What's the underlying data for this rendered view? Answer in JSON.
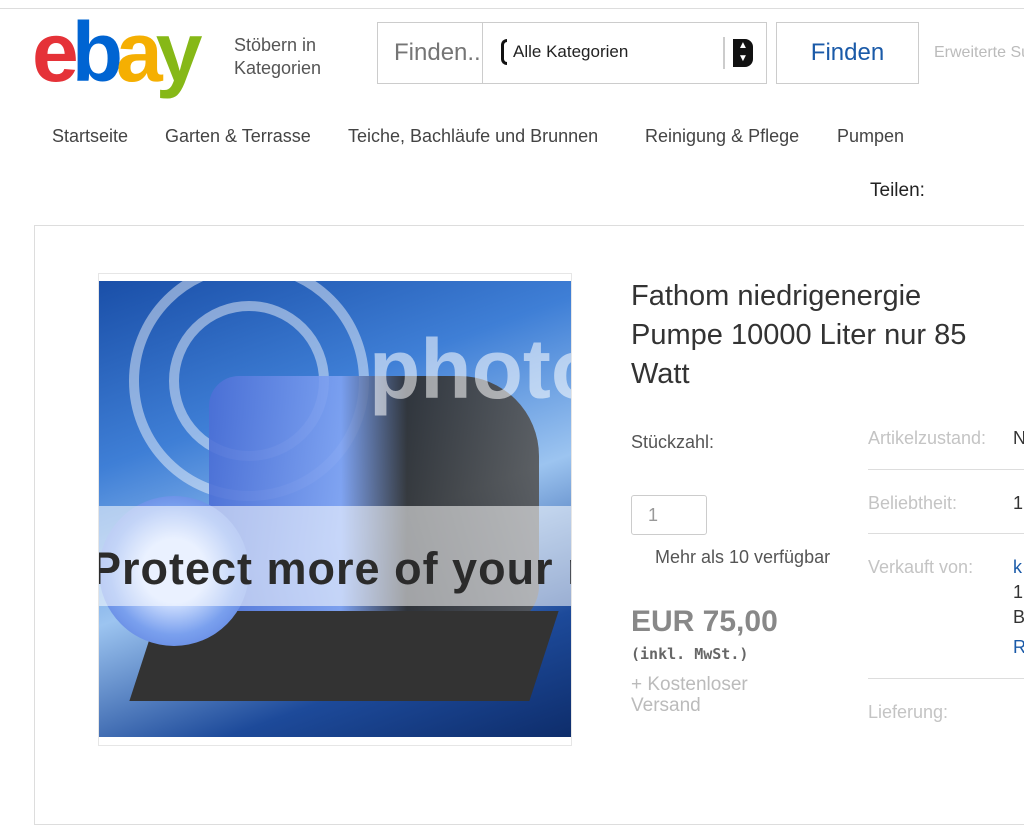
{
  "header": {
    "logo_letters": [
      "e",
      "b",
      "a",
      "y"
    ],
    "logo_colors": [
      "#e53238",
      "#0064d2",
      "#f5af02",
      "#86b817"
    ],
    "browse_label_line1": "Stöbern in",
    "browse_label_line2": "Kategorien",
    "search_placeholder": "Finden...",
    "category_selected": "Alle Kategorien",
    "find_button": "Finden",
    "advanced_link": "Erweiterte Suche"
  },
  "breadcrumbs": [
    "Startseite",
    "Garten & Terrasse",
    "Teiche, Bachläufe und Brunnen",
    "Reinigung & Pflege",
    "Pumpen"
  ],
  "share_label": "Teilen:",
  "product": {
    "title": "Fathom niedrigenergie Pumpe 10000 Liter nur 85 Watt",
    "watermark_top": "photo",
    "watermark_band": "Protect more of your memories",
    "quantity_label": "Stückzahl:",
    "quantity_value": "1",
    "availability": "Mehr als 10 verfügbar",
    "price": "EUR 75,00",
    "tax_note": "(inkl. MwSt.)",
    "shipping": "+ Kostenloser Versand"
  },
  "specs": [
    {
      "label": "Artikelzustand:",
      "value": "N"
    },
    {
      "label": "Beliebtheit:",
      "value": "1"
    },
    {
      "label": "Verkauft von:",
      "value": "k"
    },
    {
      "label": "Lieferung:",
      "value": ""
    }
  ],
  "seller_extra": [
    "1",
    "B",
    "R"
  ]
}
